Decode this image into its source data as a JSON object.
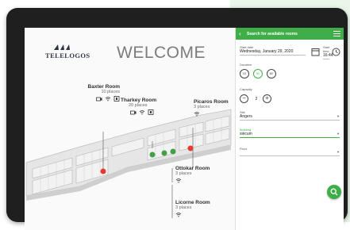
{
  "welcome": "WELCOME",
  "logo_text": "TELELOGOS",
  "rooms": [
    {
      "name": "Baxter Room",
      "places": "10 places",
      "icons": [
        "camera-icon",
        "wifi-icon",
        "screen-icon"
      ]
    },
    {
      "name": "Tharkey Room",
      "places": "20 places",
      "icons": [
        "camera-icon",
        "wifi-icon",
        "screen-icon"
      ]
    },
    {
      "name": "Picaros Room",
      "places": "3 places",
      "icons": [
        "wifi-icon"
      ]
    },
    {
      "name": "Ottokar Room",
      "places": "3 places",
      "icons": [
        "wifi-icon"
      ]
    },
    {
      "name": "Licorne Room",
      "places": "3 places",
      "icons": [
        "wifi-icon"
      ]
    }
  ],
  "app": {
    "title": "Search for available rooms",
    "start_date_label": "Start date",
    "start_date_value": "Wednesday, January 29, 2020",
    "start_time_label": "Start time",
    "start_time_value": "16:44",
    "duration_label": "Duration",
    "durations": [
      "15'",
      "30'",
      "60'"
    ],
    "capacity_label": "Capacity",
    "capacity_value": "2",
    "site_label": "Site",
    "site_value": "Angers",
    "building_label": "Building",
    "building_value": "siècum",
    "floor_label": "Floor",
    "floor_value": ""
  },
  "colors": {
    "accent": "#3fae49",
    "occupied": "#e53935",
    "available": "#43a047"
  }
}
